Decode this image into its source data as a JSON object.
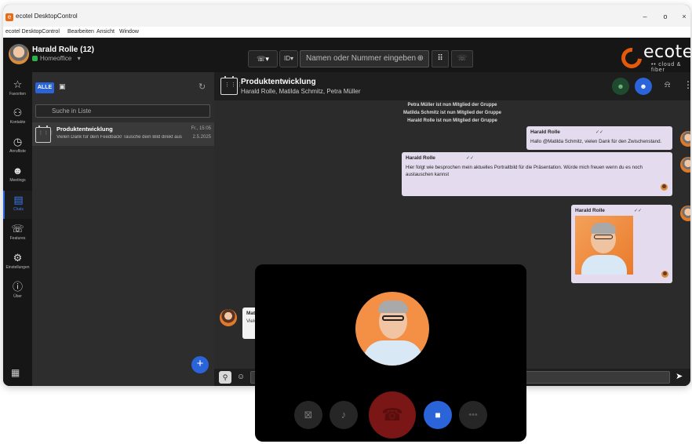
{
  "window": {
    "title": "ecotel DesktopControl",
    "minimize": "–",
    "maximize": "o",
    "close": "×",
    "icon_glyph": "e"
  },
  "menubar": [
    "ecotel DesktopControl",
    "Bearbeiten",
    "Ansicht",
    "Window"
  ],
  "user": {
    "name": "Harald Rolle (12)",
    "status": "Homeoffice",
    "status_caret": "▾",
    "status_color": "#2bb24c"
  },
  "toolbar": {
    "call_label": "☏▾",
    "id_label": "ID▾",
    "search_placeholder": "Namen oder Nummer eingeben",
    "search_add_icon": "⊕",
    "dialpad_icon": "⠿",
    "call_icon": "☏"
  },
  "logo": {
    "text": "ecotel",
    "subtitle": "•• cloud & fiber",
    "accent": "#e55a0a"
  },
  "nav": [
    {
      "id": "favoriten",
      "icon": "☆",
      "label": "Favoriten"
    },
    {
      "id": "kontakte",
      "icon": "⚇",
      "label": "Kontakte"
    },
    {
      "id": "anrufliste",
      "icon": "◷",
      "label": "Anrufliste"
    },
    {
      "id": "meetings",
      "icon": "☻",
      "label": "Meetings"
    },
    {
      "id": "chats",
      "icon": "▤",
      "label": "Chats"
    },
    {
      "id": "features",
      "icon": "☏",
      "label": "Features"
    },
    {
      "id": "einstellungen",
      "icon": "⚙",
      "label": "Einstellungen"
    },
    {
      "id": "ueber",
      "icon": "ⓘ",
      "label": "Über"
    }
  ],
  "nav_qr_icon": "▦",
  "list": {
    "tab_all": "ALLE",
    "tab_chat_icon": "▣",
    "refresh_icon": "↻",
    "search_icon": "⚲",
    "search_placeholder": "Suche in Liste",
    "items": [
      {
        "name": "Produktentwicklung",
        "time": "Fr., 15:05",
        "preview": "Vielen Dank für dein Feedback! Tausche dein Bild direkt aus.",
        "date": "2.5.2025",
        "icon_dots": "⋮⋮⋮"
      }
    ],
    "fab": "+"
  },
  "chat": {
    "title": "Produktentwicklung",
    "members": "Harald Rolle, Matilda Schmitz, Petra Müller",
    "header_icon_dots": "⋮⋮⋮",
    "group_btn_icon": "☻",
    "group_btn2_icon": "☻",
    "bell_icon": "⍾",
    "more_icon": "⋮",
    "system_messages": [
      "Petra Müller ist nun Mitglied der Gruppe",
      "Matilda Schmitz ist nun Mitglied der Gruppe",
      "Harald Rolle ist nun Mitglied der Gruppe"
    ],
    "messages": [
      {
        "sender": "Harald Rolle",
        "check": "✓✓",
        "text": "Hallo @Matilda Schmitz, vielen Dank für den Zwischenstand."
      },
      {
        "sender": "Harald Rolle",
        "check": "✓✓",
        "text_line1": "Hier folgt wie besprochen mein aktuelles Portraitbild für die Präsentation. Würde mich freuen wenn du es noch",
        "text_line2": "austauschen kannst"
      },
      {
        "sender": "Harald Rolle",
        "check": "✓✓"
      }
    ],
    "received": {
      "sender": "Mati",
      "text": "Viele"
    },
    "composer": {
      "attach_icon": "⚲",
      "emoji_icon": "☺",
      "send_icon": "➤"
    }
  },
  "call": {
    "cam_off_icon": "⊠",
    "mic_icon": "♪",
    "hangup_icon": "☎",
    "video_icon": "■",
    "more_icon": "•••",
    "hangup_color": "#7a1616",
    "video_color": "#2b63d9"
  }
}
